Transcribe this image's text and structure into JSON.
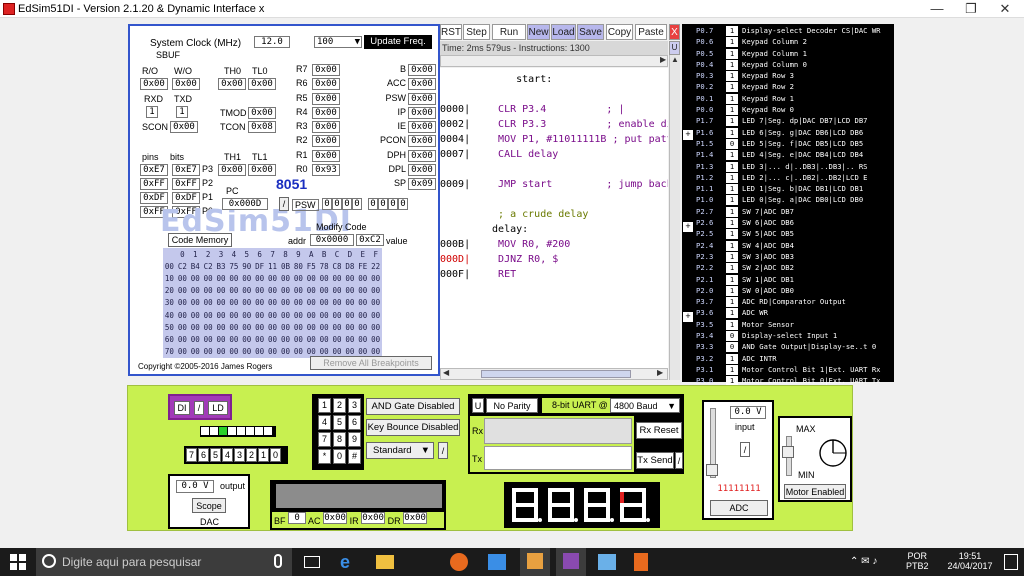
{
  "window": {
    "title": "EdSim51DI - Version 2.1.20 & Dynamic Interface x",
    "min": "—",
    "max": "❐",
    "close": "✕"
  },
  "registers": {
    "sysclock_label": "System Clock (MHz)",
    "sysclock_value": "12.0",
    "update_select": "100",
    "update_button": "Update Freq.",
    "sbuf": "SBUF",
    "rw_label": "R/O",
    "wo_label": "W/O",
    "sbuf_ro": "0x00",
    "sbuf_wo": "0x00",
    "rxd": "RXD",
    "txd": "TXD",
    "rxd_v": "1",
    "txd_v": "1",
    "scon": "SCON",
    "scon_v": "0x00",
    "th0": "TH0",
    "tl0": "TL0",
    "th0_v": "0x00",
    "tl0_v": "0x00",
    "tmod": "TMOD",
    "tmod_v": "0x00",
    "tcon": "TCON",
    "tcon_v": "0x08",
    "th1": "TH1",
    "tl1": "TL1",
    "th1_v": "0x00",
    "tl1_v": "0x00",
    "pins": "pins",
    "bits": "bits",
    "ports": [
      {
        "pins": "0xE7",
        "bits": "0xE7",
        "name": "P3"
      },
      {
        "pins": "0xFF",
        "bits": "0xFF",
        "name": "P2"
      },
      {
        "pins": "0xDF",
        "bits": "0xDF",
        "name": "P1"
      },
      {
        "pins": "0xFF",
        "bits": "0xFF",
        "name": "P0"
      }
    ],
    "rregs": [
      {
        "n": "R7",
        "v": "0x00"
      },
      {
        "n": "R6",
        "v": "0x00"
      },
      {
        "n": "R5",
        "v": "0x00"
      },
      {
        "n": "R4",
        "v": "0x00"
      },
      {
        "n": "R3",
        "v": "0x00"
      },
      {
        "n": "R2",
        "v": "0x00"
      },
      {
        "n": "R1",
        "v": "0x00"
      },
      {
        "n": "R0",
        "v": "0x93"
      }
    ],
    "sfr": [
      {
        "n": "B",
        "v": "0x00"
      },
      {
        "n": "ACC",
        "v": "0x00"
      },
      {
        "n": "PSW",
        "v": "0x00"
      },
      {
        "n": "IP",
        "v": "0x00"
      },
      {
        "n": "IE",
        "v": "0x00"
      },
      {
        "n": "PCON",
        "v": "0x00"
      },
      {
        "n": "DPH",
        "v": "0x00"
      },
      {
        "n": "DPL",
        "v": "0x00"
      },
      {
        "n": "SP",
        "v": "0x09"
      }
    ],
    "chip": "8051",
    "pc": "PC",
    "pc_v": "0x000D",
    "psw_label": "PSW",
    "psw_bits": [
      "0",
      "0",
      "0",
      "0",
      "0",
      "0",
      "0",
      "0"
    ],
    "modify_code": "Modify Code",
    "addr": "addr",
    "addr_v": "0x0000",
    "code_v": "0xC2",
    "value": "value",
    "code_memory": "Code Memory",
    "mem_cols": [
      "0",
      "1",
      "2",
      "3",
      "4",
      "5",
      "6",
      "7",
      "8",
      "9",
      "A",
      "B",
      "C",
      "D",
      "E",
      "F"
    ],
    "mem_rows": [
      {
        "a": "00",
        "d": [
          "C2",
          "B4",
          "C2",
          "B3",
          "75",
          "90",
          "DF",
          "11",
          "0B",
          "80",
          "F5",
          "78",
          "C8",
          "D8",
          "FE",
          "22"
        ]
      },
      {
        "a": "10",
        "d": [
          "00",
          "00",
          "00",
          "00",
          "00",
          "00",
          "00",
          "00",
          "00",
          "00",
          "00",
          "00",
          "00",
          "00",
          "00",
          "00"
        ]
      },
      {
        "a": "20",
        "d": [
          "00",
          "00",
          "00",
          "00",
          "00",
          "00",
          "00",
          "00",
          "00",
          "00",
          "00",
          "00",
          "00",
          "00",
          "00",
          "00"
        ]
      },
      {
        "a": "30",
        "d": [
          "00",
          "00",
          "00",
          "00",
          "00",
          "00",
          "00",
          "00",
          "00",
          "00",
          "00",
          "00",
          "00",
          "00",
          "00",
          "00"
        ]
      },
      {
        "a": "40",
        "d": [
          "00",
          "00",
          "00",
          "00",
          "00",
          "00",
          "00",
          "00",
          "00",
          "00",
          "00",
          "00",
          "00",
          "00",
          "00",
          "00"
        ]
      },
      {
        "a": "50",
        "d": [
          "00",
          "00",
          "00",
          "00",
          "00",
          "00",
          "00",
          "00",
          "00",
          "00",
          "00",
          "00",
          "00",
          "00",
          "00",
          "00"
        ]
      },
      {
        "a": "60",
        "d": [
          "00",
          "00",
          "00",
          "00",
          "00",
          "00",
          "00",
          "00",
          "00",
          "00",
          "00",
          "00",
          "00",
          "00",
          "00",
          "00"
        ]
      },
      {
        "a": "70",
        "d": [
          "00",
          "00",
          "00",
          "00",
          "00",
          "00",
          "00",
          "00",
          "00",
          "00",
          "00",
          "00",
          "00",
          "00",
          "00",
          "00"
        ]
      }
    ],
    "remove_bp": "Remove All Breakpoints",
    "copyright": "Copyright ©2005-2016 James Rogers",
    "watermark": "EdSim51DI"
  },
  "toolbar": {
    "rst": "RST",
    "step": "Step",
    "run": "Run",
    "new": "New",
    "load": "Load",
    "save": "Save",
    "copy": "Copy",
    "paste": "Paste",
    "x": "X",
    "u": "U"
  },
  "status": "Time: 2ms 579us - Instructions: 1300",
  "code": [
    {
      "a": "",
      "t": "      start:",
      "c": "#000"
    },
    {
      "a": "",
      "t": "",
      "c": "#000"
    },
    {
      "a": "0000|",
      "t": "   CLR P3.4          ; |",
      "c": "#7a0c8a"
    },
    {
      "a": "0002|",
      "t": "   CLR P3.3          ; enable di",
      "c": "#7a0c8a"
    },
    {
      "a": "0004|",
      "t": "   MOV P1, #11011111B ; put patte",
      "c": "#7a0c8a"
    },
    {
      "a": "0007|",
      "t": "   CALL delay",
      "c": "#7a0c8a"
    },
    {
      "a": "",
      "t": "",
      "c": "#000"
    },
    {
      "a": "0009|",
      "t": "   JMP start         ; jump back",
      "c": "#7a0c8a"
    },
    {
      "a": "",
      "t": "",
      "c": "#000"
    },
    {
      "a": "",
      "t": "   ; a crude delay",
      "c": "#6a7a00"
    },
    {
      "a": "",
      "t": "  delay:",
      "c": "#000"
    },
    {
      "a": "000B|",
      "t": "   MOV R0, #200",
      "c": "#7a0c8a"
    },
    {
      "a": "000D|",
      "t": "   DJNZ R0, $",
      "c": "#7a0c8a"
    },
    {
      "a": "000F|",
      "t": "   RET",
      "c": "#7a0c8a"
    }
  ],
  "pins": [
    {
      "p": "P0.7",
      "v": "1",
      "d": "Display-select Decoder CS|DAC WR"
    },
    {
      "p": "P0.6",
      "v": "1",
      "d": "Keypad Column 2"
    },
    {
      "p": "P0.5",
      "v": "1",
      "d": "Keypad Column 1"
    },
    {
      "p": "P0.4",
      "v": "1",
      "d": "Keypad Column 0"
    },
    {
      "p": "P0.3",
      "v": "1",
      "d": "Keypad Row 3"
    },
    {
      "p": "P0.2",
      "v": "1",
      "d": "Keypad Row 2"
    },
    {
      "p": "P0.1",
      "v": "1",
      "d": "Keypad Row 1"
    },
    {
      "p": "P0.0",
      "v": "1",
      "d": "Keypad Row 0"
    },
    {
      "p": "P1.7",
      "v": "1",
      "d": "LED 7|Seg. dp|DAC DB7|LCD DB7"
    },
    {
      "p": "P1.6",
      "v": "1",
      "d": "LED 6|Seg. g|DAC DB6|LCD DB6"
    },
    {
      "p": "P1.5",
      "v": "0",
      "d": "LED 5|Seg. f|DAC DB5|LCD DB5"
    },
    {
      "p": "P1.4",
      "v": "1",
      "d": "LED 4|Seg. e|DAC DB4|LCD DB4"
    },
    {
      "p": "P1.3",
      "v": "1",
      "d": "LED 3|... d|..DB3|..DB3|.. RS"
    },
    {
      "p": "P1.2",
      "v": "1",
      "d": "LED 2|... c|..DB2|..DB2|LCD E"
    },
    {
      "p": "P1.1",
      "v": "1",
      "d": "LED 1|Seg. b|DAC DB1|LCD DB1"
    },
    {
      "p": "P1.0",
      "v": "1",
      "d": "LED 0|Seg. a|DAC DB0|LCD DB0"
    },
    {
      "p": "P2.7",
      "v": "1",
      "d": "SW 7|ADC DB7"
    },
    {
      "p": "P2.6",
      "v": "1",
      "d": "SW 6|ADC DB6"
    },
    {
      "p": "P2.5",
      "v": "1",
      "d": "SW 5|ADC DB5"
    },
    {
      "p": "P2.4",
      "v": "1",
      "d": "SW 4|ADC DB4"
    },
    {
      "p": "P2.3",
      "v": "1",
      "d": "SW 3|ADC DB3"
    },
    {
      "p": "P2.2",
      "v": "1",
      "d": "SW 2|ADC DB2"
    },
    {
      "p": "P2.1",
      "v": "1",
      "d": "SW 1|ADC DB1"
    },
    {
      "p": "P2.0",
      "v": "1",
      "d": "SW 0|ADC DB0"
    },
    {
      "p": "P3.7",
      "v": "1",
      "d": "ADC RD|Comparator Output"
    },
    {
      "p": "P3.6",
      "v": "1",
      "d": "ADC WR"
    },
    {
      "p": "P3.5",
      "v": "1",
      "d": "Motor Sensor"
    },
    {
      "p": "P3.4",
      "v": "0",
      "d": "Display-select Input 1"
    },
    {
      "p": "P3.3",
      "v": "0",
      "d": "AND Gate Output|Display-se..t 0"
    },
    {
      "p": "P3.2",
      "v": "1",
      "d": "ADC INTR"
    },
    {
      "p": "P3.1",
      "v": "1",
      "d": "Motor Control Bit 1|Ext. UART Rx"
    },
    {
      "p": "P3.0",
      "v": "1",
      "d": "Motor Control Bit 0|Ext. UART Tx"
    }
  ],
  "peripherals": {
    "di": "DI",
    "ld": "LD",
    "slash": "/",
    "switches": [
      "7",
      "6",
      "5",
      "4",
      "3",
      "2",
      "1",
      "0"
    ],
    "dac_v": "0.0 V",
    "output": "output",
    "scope": "Scope",
    "dac": "DAC",
    "keys": [
      "1",
      "2",
      "3",
      "4",
      "5",
      "6",
      "7",
      "8",
      "9",
      "*",
      "0",
      "#"
    ],
    "and_gate": "AND Gate Disabled",
    "key_bounce": "Key Bounce Disabled",
    "standard": "Standard",
    "lcd": {
      "bf": "BF",
      "bf_v": "0",
      "ac": "AC",
      "ac_v": "0x00",
      "ir": "IR",
      "ir_v": "0x00",
      "dr": "DR",
      "dr_v": "0x00"
    },
    "u": "U",
    "parity": "No Parity",
    "uart": "8-bit UART @",
    "baud": "4800 Baud",
    "rx": "Rx",
    "tx": "Tx",
    "rx_reset": "Rx Reset",
    "tx_send": "Tx Send",
    "adc_v": "0.0 V",
    "input": "input",
    "adc_bits": "11111111",
    "adc": "ADC",
    "max": "MAX",
    "min": "MIN",
    "motor": "Motor Enabled"
  },
  "taskbar": {
    "search": "Digite aqui para pesquisar",
    "lang1": "POR",
    "lang2": "PTB2",
    "time": "19:51",
    "date": "24/04/2017"
  },
  "colors": {
    "accent": "#7a0c8a",
    "pinpanel": "#000000",
    "periph": "#c8f050",
    "dac_bg": "#cc44cc"
  }
}
